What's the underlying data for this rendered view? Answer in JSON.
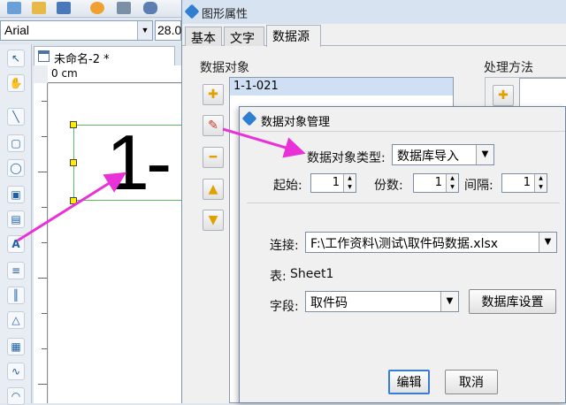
{
  "font_bar": {
    "font_name": "Arial",
    "font_size": "28.0"
  },
  "document": {
    "tab_title": "未命名-2 *",
    "ruler_origin": "0 cm",
    "canvas_text": "1-"
  },
  "props_window": {
    "title": "图形属性",
    "tabs": [
      {
        "label": "基本"
      },
      {
        "label": "文字"
      },
      {
        "label": "数据源"
      }
    ],
    "data_objects_label": "数据对象",
    "data_objects": [
      "1-1-021"
    ],
    "processing_label": "处理方法"
  },
  "dialog": {
    "title": "数据对象管理",
    "type_label": "数据对象类型:",
    "type_value": "数据库导入",
    "start_label": "起始:",
    "start_value": "1",
    "copies_label": "份数:",
    "copies_value": "1",
    "interval_label": "间隔:",
    "interval_value": "1",
    "connection_label": "连接:",
    "connection_value": "F:\\工作资料\\测试\\取件码数据.xlsx",
    "table_label": "表:",
    "table_value": "Sheet1",
    "field_label": "字段:",
    "field_value": "取件码",
    "db_settings_button": "数据库设置",
    "edit_button": "编辑",
    "cancel_button": "取消"
  },
  "colors": {
    "annotation_arrow": "#e832d8",
    "selection_handle": "#ffee00",
    "selected_row": "#cfe0f4"
  }
}
